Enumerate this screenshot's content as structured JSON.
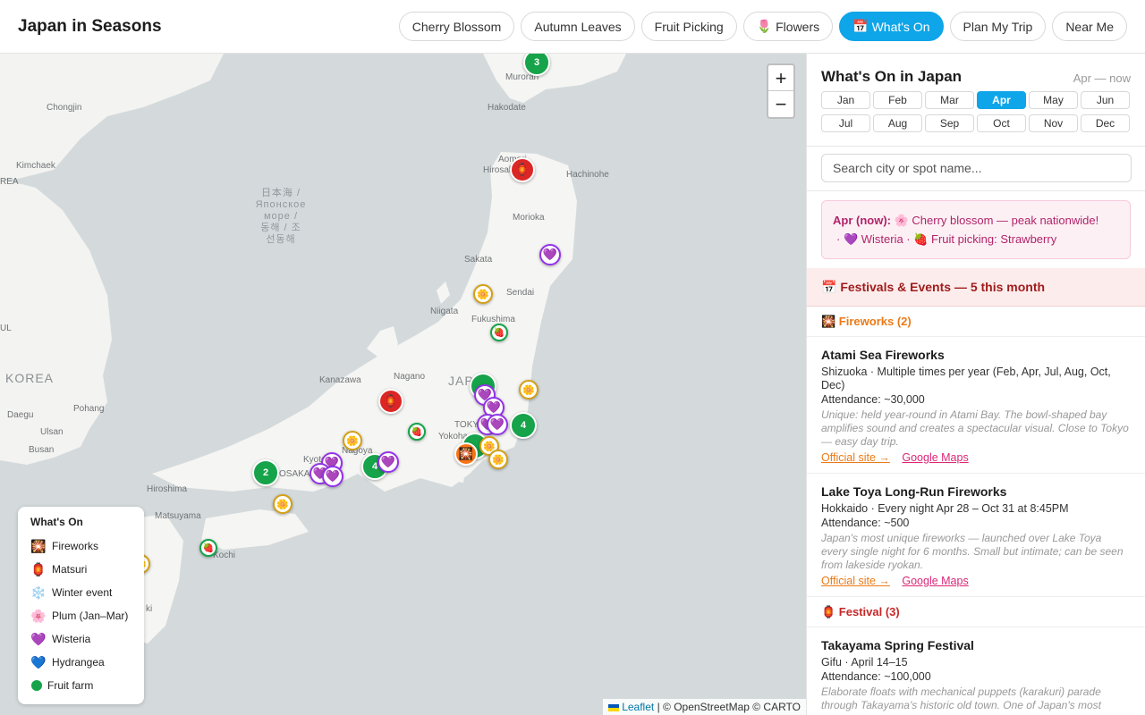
{
  "app": {
    "title": "Japan in Seasons"
  },
  "nav": [
    {
      "label": "Cherry Blossom",
      "icon": "",
      "active": false
    },
    {
      "label": "Autumn Leaves",
      "icon": "",
      "active": false
    },
    {
      "label": "Fruit Picking",
      "icon": "",
      "active": false
    },
    {
      "label": "Flowers",
      "icon": "🌷",
      "active": false
    },
    {
      "label": "What's On",
      "icon": "📅",
      "active": true
    },
    {
      "label": "Plan My Trip",
      "icon": "",
      "active": false
    },
    {
      "label": "Near Me",
      "icon": "",
      "active": false
    }
  ],
  "map": {
    "places": [
      "Muroran",
      "Hakodate",
      "Chongjin",
      "Kimchaek",
      "Aomori",
      "Hirosaki",
      "Hachinohe",
      "Morioka",
      "Sakata",
      "Sendai",
      "Niigata",
      "Fukushima",
      "Kanazawa",
      "Nagano",
      "KOREA",
      "Pohang",
      "Ulsan",
      "Daegu",
      "Busan",
      "Kyoto",
      "Nagoya",
      "OSAKA",
      "Yokohama",
      "TOKYO",
      "JAPAN",
      "Hiroshima",
      "Matsuyama",
      "Kochi",
      "UL",
      "REA",
      "ki"
    ],
    "sea_label": [
      "日本海 /",
      "Японское",
      "море /",
      "동해 / 조",
      "선동해"
    ],
    "zoom_in": "+",
    "zoom_out": "−",
    "attribution_link": "Leaflet",
    "attribution_text": " | © OpenStreetMap © CARTO",
    "clusters": [
      "3",
      "4",
      "2",
      "4",
      "",
      ""
    ]
  },
  "legend": {
    "title": "What's On",
    "items": [
      {
        "icon": "🎇",
        "label": "Fireworks"
      },
      {
        "icon": "🏮",
        "label": "Matsuri"
      },
      {
        "icon": "❄️",
        "label": "Winter event"
      },
      {
        "icon": "🌸",
        "label": "Plum (Jan–Mar)"
      },
      {
        "icon": "💜",
        "label": "Wisteria"
      },
      {
        "icon": "💙",
        "label": "Hydrangea"
      },
      {
        "icon": "dot",
        "label": "Fruit farm"
      }
    ]
  },
  "panel": {
    "title": "What's On in Japan",
    "range": "Apr — now",
    "months": [
      "Jan",
      "Feb",
      "Mar",
      "Apr",
      "May",
      "Jun",
      "Jul",
      "Aug",
      "Sep",
      "Oct",
      "Nov",
      "Dec"
    ],
    "active_month": "Apr",
    "search_placeholder": "Search city or spot name...",
    "now": {
      "prefix": "Apr (now):",
      "line1": " 🌸 Cherry blossom — peak nationwide!",
      "line2": "· 💜 Wisteria · 🍓 Fruit picking: Strawberry"
    },
    "festivals_header": "📅 Festivals & Events — 5 this month",
    "categories": [
      {
        "label": "🎇 Fireworks (2)",
        "events": [
          {
            "name": "Atami Sea Fireworks",
            "meta": "Shizuoka · Multiple times per year (Feb, Apr, Jul, Aug, Oct, Dec)",
            "attendance": "Attendance: ~30,000",
            "desc": "Unique: held year-round in Atami Bay. The bowl-shaped bay amplifies sound and creates a spectacular visual. Close to Tokyo — easy day trip.",
            "official": "Official site →",
            "gmaps": "Google Maps"
          },
          {
            "name": "Lake Toya Long-Run Fireworks",
            "meta": "Hokkaido · Every night Apr 28 – Oct 31 at 8:45PM",
            "attendance": "Attendance: ~500",
            "desc": "Japan's most unique fireworks — launched over Lake Toya every single night for 6 months. Small but intimate; can be seen from lakeside ryokan.",
            "official": "Official site →",
            "gmaps": "Google Maps"
          }
        ]
      },
      {
        "label": "🏮 Festival (3)",
        "events": [
          {
            "name": "Takayama Spring Festival",
            "meta": "Gifu · April 14–15",
            "attendance": "Attendance: ~100,000",
            "desc": "Elaborate floats with mechanical puppets (karakuri) parade through Takayama's historic old town. One of Japan's most"
          }
        ]
      }
    ]
  },
  "colors": {
    "accent": "#0ea5e9",
    "cluster": "#16a34a",
    "matsuri": "#dc2626",
    "wisteria": "#9333ea",
    "festival_bg": "#fdecec"
  }
}
